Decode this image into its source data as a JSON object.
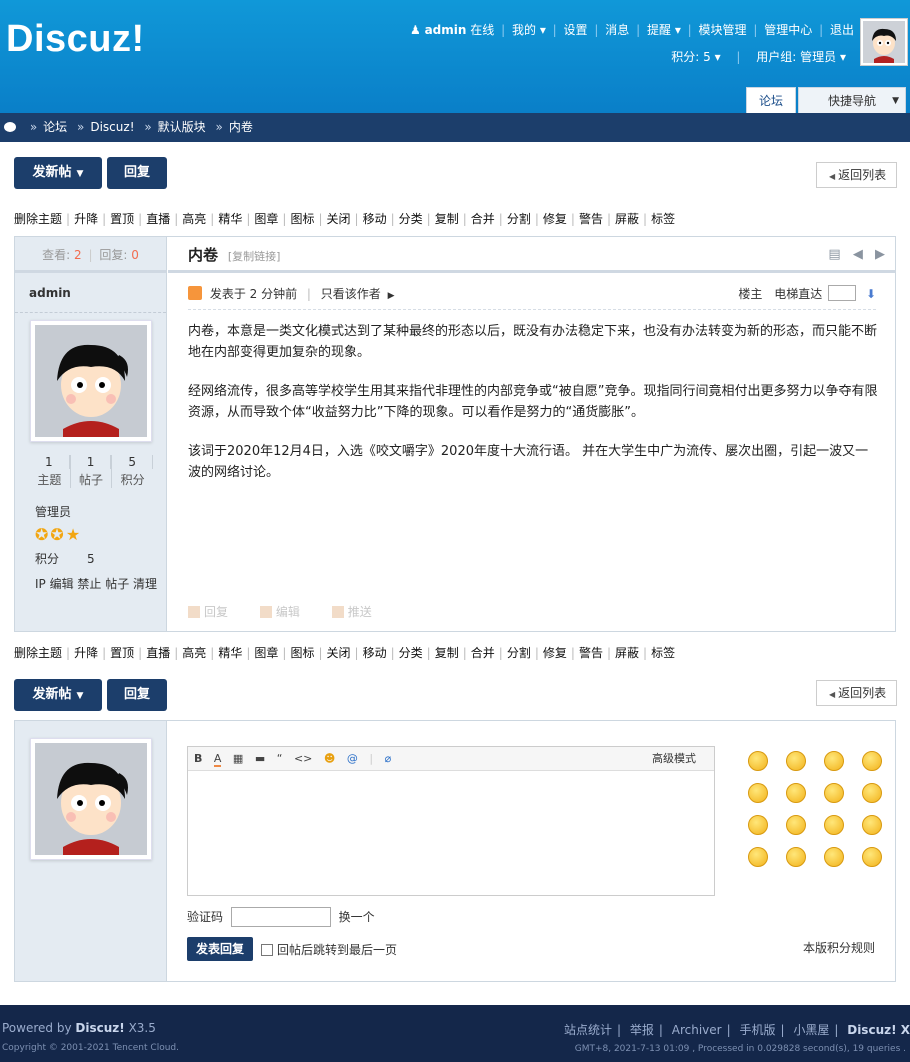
{
  "header": {
    "logo": "Discuz!",
    "user": "admin",
    "online": "在线",
    "nav": [
      "我的",
      "设置",
      "消息",
      "提醒",
      "模块管理",
      "管理中心",
      "退出"
    ],
    "credits": "积分: 5",
    "group": "用户组: 管理员",
    "tabs": {
      "forum": "论坛",
      "quicknav": "快捷导航"
    }
  },
  "breadcrumb": [
    "论坛",
    "Discuz!",
    "默认版块",
    "内卷"
  ],
  "actions": {
    "new_thread": "发新帖",
    "reply": "回复",
    "back": "返回列表"
  },
  "modbar": [
    "删除主题",
    "升降",
    "置顶",
    "直播",
    "高亮",
    "精华",
    "图章",
    "图标",
    "关闭",
    "移动",
    "分类",
    "复制",
    "合并",
    "分割",
    "修复",
    "警告",
    "屏蔽",
    "标签"
  ],
  "thread": {
    "views_label": "查看:",
    "views": "2",
    "replies_label": "回复:",
    "replies": "0",
    "title": "内卷",
    "copy_link": "[复制链接]",
    "author": "admin",
    "posted": "发表于 2 分钟前",
    "only_author": "只看该作者",
    "floor": "楼主",
    "elevator": "电梯直达",
    "paragraphs": [
      "内卷，本意是一类文化模式达到了某种最终的形态以后，既没有办法稳定下来，也没有办法转变为新的形态，而只能不断地在内部变得更加复杂的现象。",
      "经网络流传，很多高等学校学生用其来指代非理性的内部竞争或“被自愿”竞争。现指同行间竟相付出更多努力以争夺有限资源，从而导致个体“收益努力比”下降的现象。可以看作是努力的“通货膨胀”。",
      "该词于2020年12月4日，入选《咬文嚼字》2020年度十大流行语。 并在大学生中广为流传、屡次出圈，引起一波又一波的网络讨论。"
    ],
    "post_actions": [
      "回复",
      "编辑",
      "推送"
    ]
  },
  "profile": {
    "stats": [
      {
        "value": "1",
        "label": "主题"
      },
      {
        "value": "1",
        "label": "帖子"
      },
      {
        "value": "5",
        "label": "积分"
      }
    ],
    "group": "管理员",
    "credit_label": "积分",
    "credit_value": "5",
    "admin_links": "IP 编辑 禁止 帖子 清理"
  },
  "editor": {
    "advanced": "高级模式",
    "captcha_label": "验证码",
    "captcha_change": "换一个",
    "submit": "发表回复",
    "jump_last": "回帖后跳转到最后一页",
    "rules": "本版积分规则"
  },
  "footer": {
    "powered": "Powered by",
    "brand": "Discuz!",
    "version": "X3.5",
    "copyright": "Copyright © 2001-2021 Tencent Cloud.",
    "links": [
      "站点统计",
      "举报",
      "Archiver",
      "手机版",
      "小黑屋"
    ],
    "brand_right": "Discuz! X",
    "gmt": "GMT+8, 2021-7-13 01:09 , Processed in 0.029828 second(s), 19 queries ."
  }
}
